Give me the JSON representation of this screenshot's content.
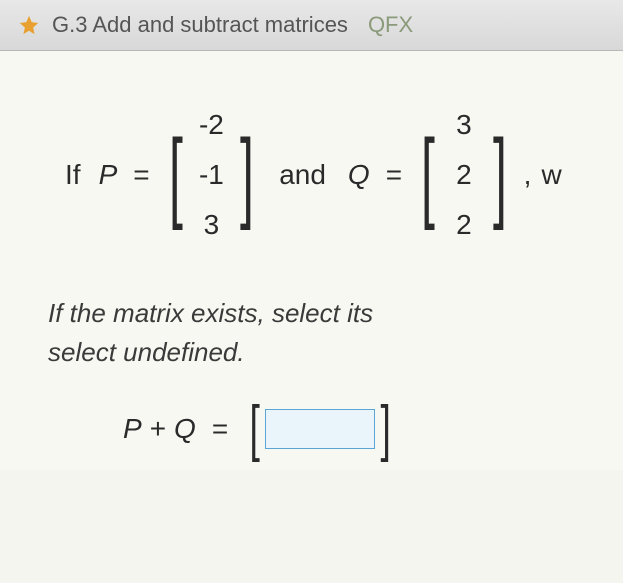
{
  "header": {
    "title": "G.3 Add and subtract matrices",
    "code": "QFX"
  },
  "problem": {
    "if_label": "If",
    "var_p": "P",
    "var_q": "Q",
    "equals": "=",
    "and_label": "and",
    "comma": ",",
    "trailing": "w",
    "matrix_p": [
      "-2",
      "-1",
      "3"
    ],
    "matrix_q": [
      "3",
      "2",
      "2"
    ]
  },
  "instruction": {
    "line1": "If the matrix exists, select its",
    "line2": "select undefined."
  },
  "answer": {
    "var_p": "P",
    "plus": "+",
    "var_q": "Q",
    "equals": "=",
    "input_value": ""
  }
}
